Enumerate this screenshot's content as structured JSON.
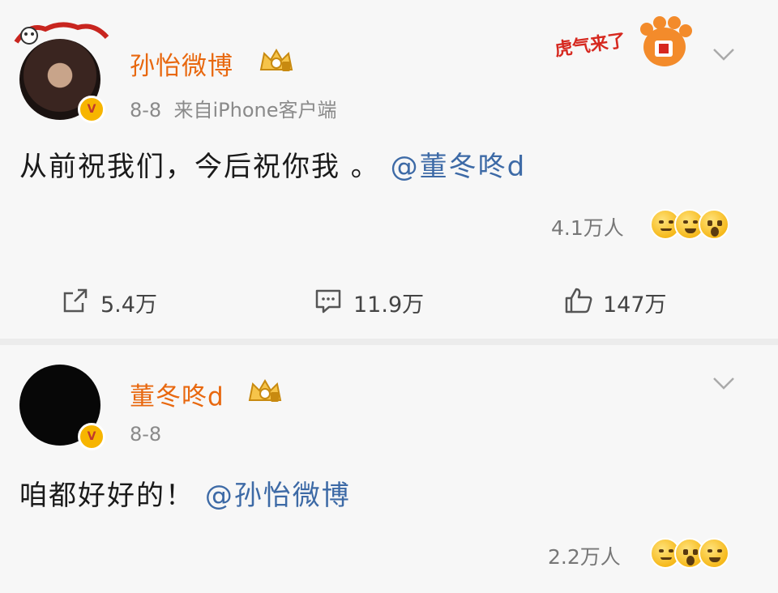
{
  "post1": {
    "author": "孙怡微博",
    "date": "8-8",
    "source": "来自iPhone客户端",
    "verified_mark": "V",
    "badge_text": "虎气来了",
    "avatar_frame_text": "虎气来了",
    "text": "从前祝我们，今后祝你我 。",
    "mention": "@董冬咚d",
    "reaction_count": "4.1万人",
    "actions": {
      "share": "5.4万",
      "comment": "11.9万",
      "like": "147万"
    }
  },
  "post2": {
    "author": "董冬咚d",
    "date": "8-8",
    "verified_mark": "V",
    "text": "咱都好好的！",
    "mention": "@孙怡微博",
    "reaction_count": "2.2万人"
  },
  "colors": {
    "name": "#e8680f",
    "mention": "#3d6aa6",
    "meta": "#8a8a8a",
    "background": "#f7f7f7"
  },
  "icons": [
    "share-icon",
    "comment-icon",
    "like-icon",
    "chevron-down-icon",
    "crown-icon",
    "verified-icon",
    "emoji-icon"
  ]
}
